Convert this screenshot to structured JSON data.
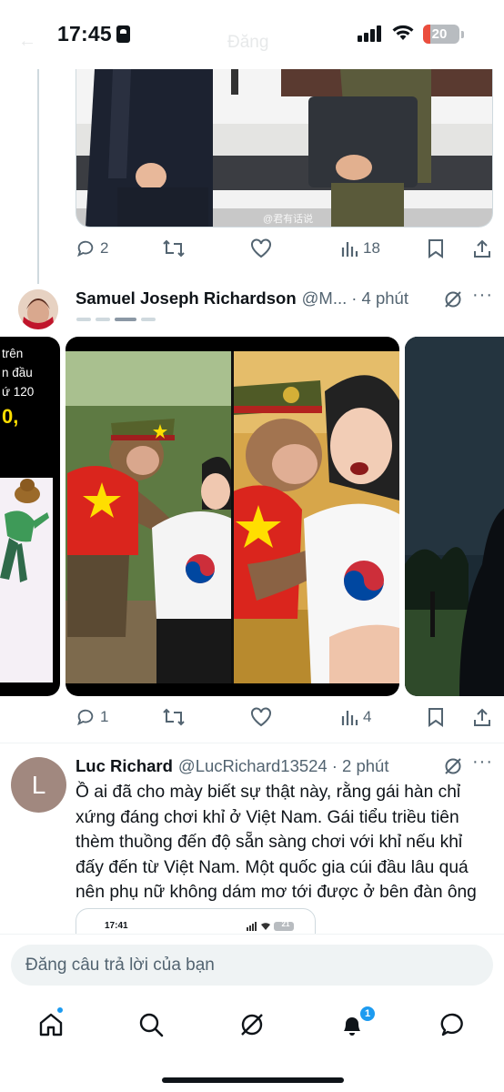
{
  "status_bar": {
    "time": "17:45",
    "battery": "20",
    "battery_level": 0.2,
    "ghost_title": "Đăng"
  },
  "tweet_top": {
    "watermark": "@君有话说",
    "actions": {
      "reply": "2",
      "retweet": "",
      "like": "",
      "views": "18"
    }
  },
  "tweet_samuel": {
    "name": "Samuel Joseph Richardson",
    "handle": "@M...",
    "time": "· 4 phút",
    "left_card_text": [
      "trên",
      "n đầu",
      "ứ 120",
      "0,"
    ],
    "actions": {
      "reply": "1",
      "retweet": "",
      "like": "",
      "views": "4"
    }
  },
  "tweet_luc": {
    "avatar_letter": "L",
    "name": "Luc Richard",
    "handle": "@LucRichard13524",
    "time": "· 2 phút",
    "lines": [
      "Ồ ai đã cho mày biết sự thật này, rằng gái hàn chỉ",
      "xứng đáng chơi khỉ ở Việt Nam. Gái tiểu triều tiên",
      "thèm thuồng đến độ sẵn sàng chơi với khỉ nếu khỉ",
      "đấy đến từ Việt Nam. Một quốc gia cúi đầu lâu quá",
      "nên phụ nữ không dám mơ tới được ở bên đàn ông"
    ],
    "quoted_time": "17:41",
    "quoted_battery": "21"
  },
  "reply_bar": {
    "placeholder": "Đăng câu trả lời của bạn"
  },
  "bottom_nav": {
    "items": [
      "home-icon",
      "search-icon",
      "grok-icon",
      "notifications-icon",
      "messages-icon"
    ],
    "notifications_badge": "1"
  },
  "colors": {
    "accent": "#1d9bf0",
    "text": "#0f1419",
    "muted": "#536471",
    "flag_red": "#da251d",
    "flag_yellow": "#ffde00"
  }
}
